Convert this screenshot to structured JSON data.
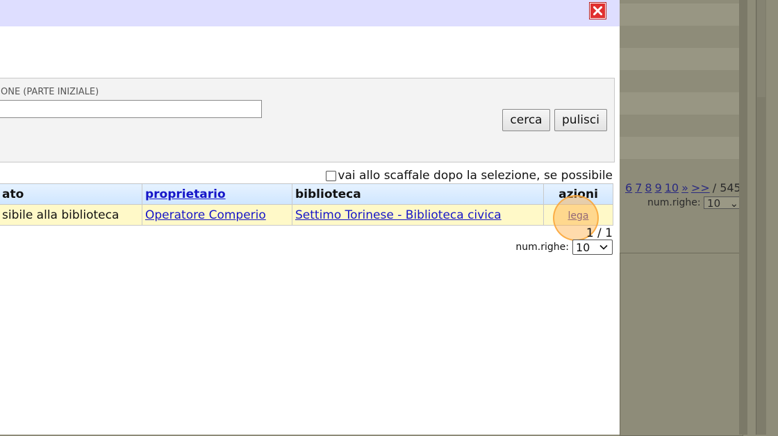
{
  "modal": {
    "search": {
      "field_label": "ONE (PARTE INIZIALE)",
      "field_value": "",
      "cerca_label": "cerca",
      "pulisci_label": "pulisci"
    },
    "checkbox_label": "vai allo scaffale dopo la selezione, se possibile",
    "checkbox_checked": false,
    "table": {
      "headers": {
        "stato": "ato",
        "proprietario": "proprietario",
        "biblioteca": "biblioteca",
        "azioni": "azioni"
      },
      "rows": [
        {
          "stato": "sibile alla biblioteca",
          "proprietario": "Operatore Comperio",
          "biblioteca": "Settimo Torinese - Biblioteca civica",
          "azioni": "lega"
        }
      ]
    },
    "page_count": "1 / 1",
    "numrighe_label": "num.righe:",
    "numrighe_value": "10"
  },
  "background": {
    "pager": [
      "6",
      "7",
      "8",
      "9",
      "10",
      "»",
      ">>"
    ],
    "pager_total": "/ 545",
    "numrighe_label": "num.righe:",
    "numrighe_value": "10"
  },
  "colors": {
    "header_bg": "#dedeff",
    "row_bg": "#fff9c8",
    "link": "#1515c8",
    "close": "#e03030",
    "highlight": "#f8a840"
  },
  "icons": {
    "close": "close-icon",
    "dropdown": "chevron-down-icon"
  }
}
